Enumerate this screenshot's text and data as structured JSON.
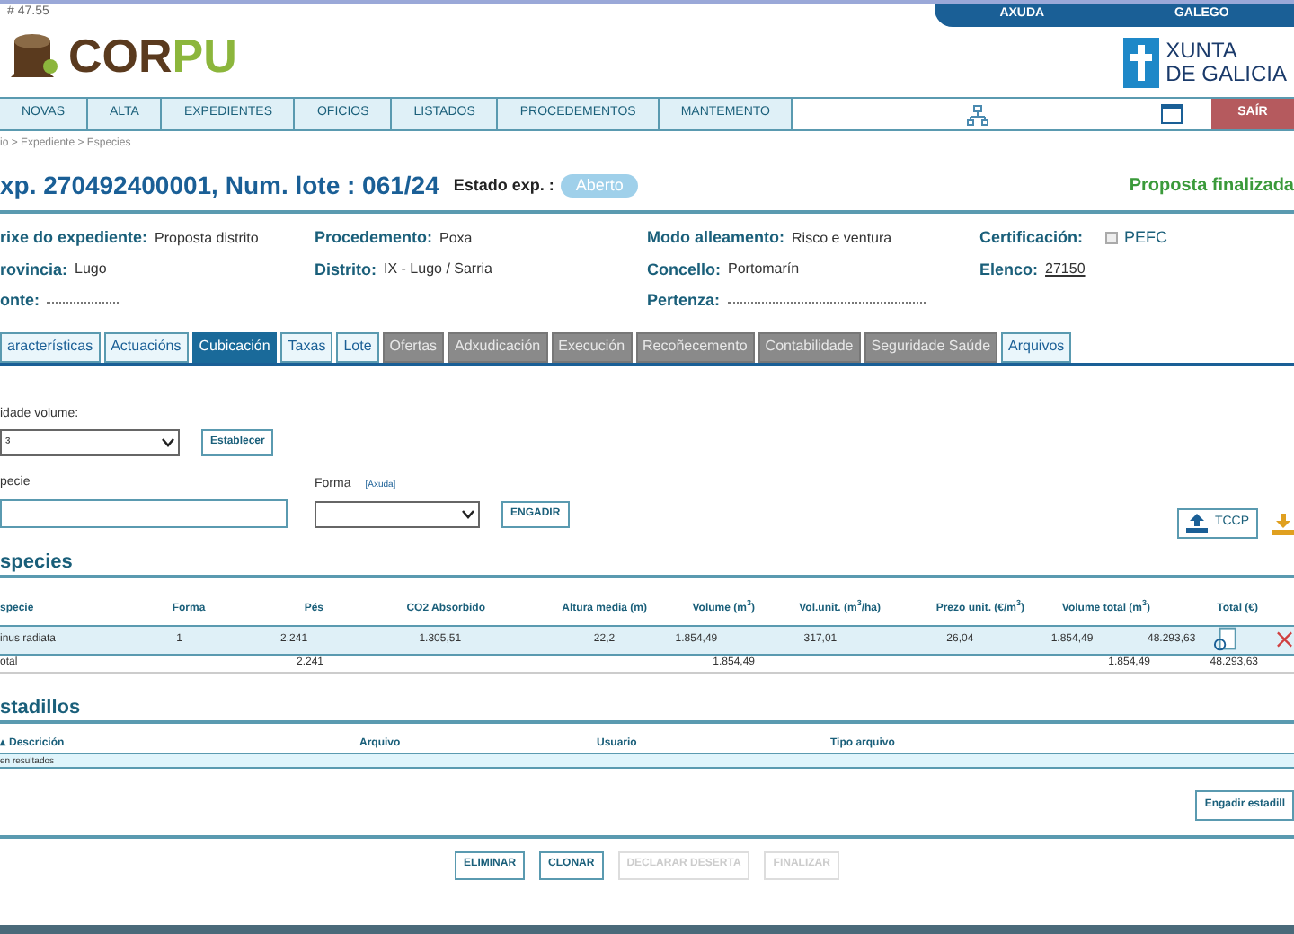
{
  "version": "# 47.55",
  "top_links": [
    "AXUDA",
    "GALEGO"
  ],
  "logo": {
    "text_a": "COR",
    "text_b": "PU"
  },
  "gov_logo": {
    "line1": "XUNTA",
    "line2": "DE GALICIA"
  },
  "nav": [
    {
      "label": "NOVAS"
    },
    {
      "label": "ALTA"
    },
    {
      "label": "EXPEDIENTES"
    },
    {
      "label": "OFICIOS"
    },
    {
      "label": "LISTADOS"
    },
    {
      "label": "PROCEDEMENTOS"
    },
    {
      "label": "MANTEMENTO"
    }
  ],
  "exit_button": "SAÍR",
  "breadcrumb": "io > Expediente > Especies",
  "title": "xp. 270492400001, Num. lote : 061/24",
  "status_label": "Estado exp. :",
  "status_badge": "Aberto",
  "status_right": "Proposta finalizada",
  "info": [
    {
      "label": "rixe do expediente:",
      "value": "Proposta distrito"
    },
    {
      "label": "Procedemento:",
      "value": "Poxa"
    },
    {
      "label": "Modo alleamento:",
      "value": "Risco e ventura"
    },
    {
      "label": "Certificación:",
      "value": "PEFC",
      "kind": "checkbox",
      "checked": false
    },
    {
      "label": "rovincia:",
      "value": "Lugo"
    },
    {
      "label": "Distrito:",
      "value": "IX - Lugo / Sarria"
    },
    {
      "label": "Concello:",
      "value": "Portomarín"
    },
    {
      "label": "Elenco:",
      "value": "27150"
    },
    {
      "label": "onte:",
      "kind": "blurred"
    },
    {
      "kind": "spacer"
    },
    {
      "label": "Pertenza:",
      "kind": "blurred"
    }
  ],
  "tabs": [
    {
      "label": "aracterísticas",
      "selected": false,
      "disabled": false
    },
    {
      "label": "Actuacións",
      "selected": false,
      "disabled": false
    },
    {
      "label": "Cubicación",
      "selected": true,
      "disabled": false
    },
    {
      "label": "Taxas",
      "selected": false,
      "disabled": false
    },
    {
      "label": "Lote",
      "selected": false,
      "disabled": false
    },
    {
      "label": "Ofertas",
      "selected": false,
      "disabled": true
    },
    {
      "label": "Adxudicación",
      "selected": false,
      "disabled": true
    },
    {
      "label": "Execución",
      "selected": false,
      "disabled": true
    },
    {
      "label": "Recoñecemento",
      "selected": false,
      "disabled": true
    },
    {
      "label": "Contabilidade",
      "selected": false,
      "disabled": true
    },
    {
      "label": "Seguridade Saúde",
      "selected": false,
      "disabled": true
    },
    {
      "label": "Arquivos",
      "selected": false,
      "disabled": false
    }
  ],
  "volume_label": "idade volume:",
  "volume_value": "³",
  "set_button": "Establecer",
  "species_label": "pecie",
  "form_label": "Forma",
  "help_link": "[Axuda]",
  "add_button": "ENGADIR",
  "tccp_button": "TCCP",
  "species_title": "species",
  "species_columns": [
    "specie",
    "Forma",
    "Pés",
    "CO2 Absorbido",
    "Altura media (m)",
    "Volume (m$^{3}$)",
    "Vol.unit. (m$^{3}$/ha)",
    "Prezo unit. (€/m$^{3}$)",
    "Volume total (m$^{3}$)",
    "Total (€)"
  ],
  "species_rows": [
    [
      "inus radiata",
      "1",
      "2.241",
      "1.305,51",
      "22,2",
      "1.854,49",
      "317,01",
      "26,04",
      "1.854,49",
      "48.293,63"
    ]
  ],
  "species_total": {
    "label": "otal",
    "pes": "2.241",
    "volume": "1.854,49",
    "volume_total": "1.854,49",
    "total": "48.293,63"
  },
  "tally_title": "stadillos",
  "tally_columns": [
    "Descrición",
    "Arquivo",
    "Usuario",
    "Tipo arquivo"
  ],
  "tally_sort_mark": "▴",
  "tally_empty": "en resultados",
  "tally_add_button": "Engadir estadill",
  "actions": [
    {
      "label": "ELIMINAR",
      "disabled": false
    },
    {
      "label": "CLONAR",
      "disabled": false
    },
    {
      "label": "DECLARAR DESERTA",
      "disabled": true
    },
    {
      "label": "FINALIZAR",
      "disabled": true
    }
  ]
}
